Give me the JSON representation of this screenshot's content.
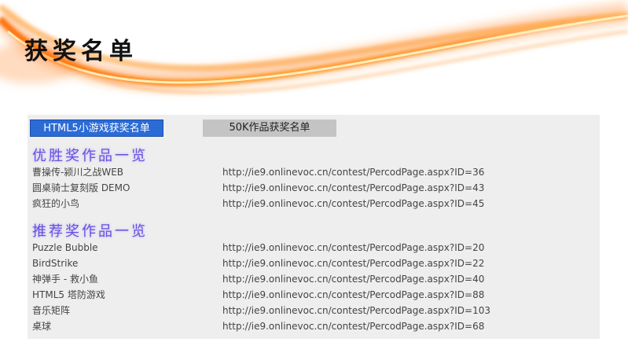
{
  "page": {
    "title": "获奖名单"
  },
  "tabs": [
    {
      "label": "HTML5小游戏获奖名单",
      "active": true
    },
    {
      "label": "50K作品获奖名单",
      "active": false
    }
  ],
  "sections": [
    {
      "heading": "优胜奖作品一览",
      "entries": [
        {
          "name": "曹操传-颍川之战WEB",
          "url": "http://ie9.onlinevoc.cn/contest/PercodPage.aspx?ID=36"
        },
        {
          "name": "圆桌骑士复刻版 DEMO",
          "url": "http://ie9.onlinevoc.cn/contest/PercodPage.aspx?ID=43"
        },
        {
          "name": "疯狂的小鸟",
          "url": "http://ie9.onlinevoc.cn/contest/PercodPage.aspx?ID=45"
        }
      ]
    },
    {
      "heading": "推荐奖作品一览",
      "entries": [
        {
          "name": "Puzzle Bubble",
          "url": "http://ie9.onlinevoc.cn/contest/PercodPage.aspx?ID=20"
        },
        {
          "name": "BirdStrike",
          "url": "http://ie9.onlinevoc.cn/contest/PercodPage.aspx?ID=22"
        },
        {
          "name": "神弹手 - 救小鱼",
          "url": "http://ie9.onlinevoc.cn/contest/PercodPage.aspx?ID=40"
        },
        {
          "name": "HTML5 塔防游戏",
          "url": "http://ie9.onlinevoc.cn/contest/PercodPage.aspx?ID=88"
        },
        {
          "name": "音乐矩阵",
          "url": "http://ie9.onlinevoc.cn/contest/PercodPage.aspx?ID=103"
        },
        {
          "name": "桌球",
          "url": "http://ie9.onlinevoc.cn/contest/PercodPage.aspx?ID=68"
        }
      ]
    }
  ],
  "colors": {
    "active_tab": "#2a6bd6",
    "inactive_tab": "#c4c4c4",
    "panel_background": "#eeeeee",
    "section_heading": "#6a4fe0",
    "banner_glow": "#ff8a1a"
  }
}
